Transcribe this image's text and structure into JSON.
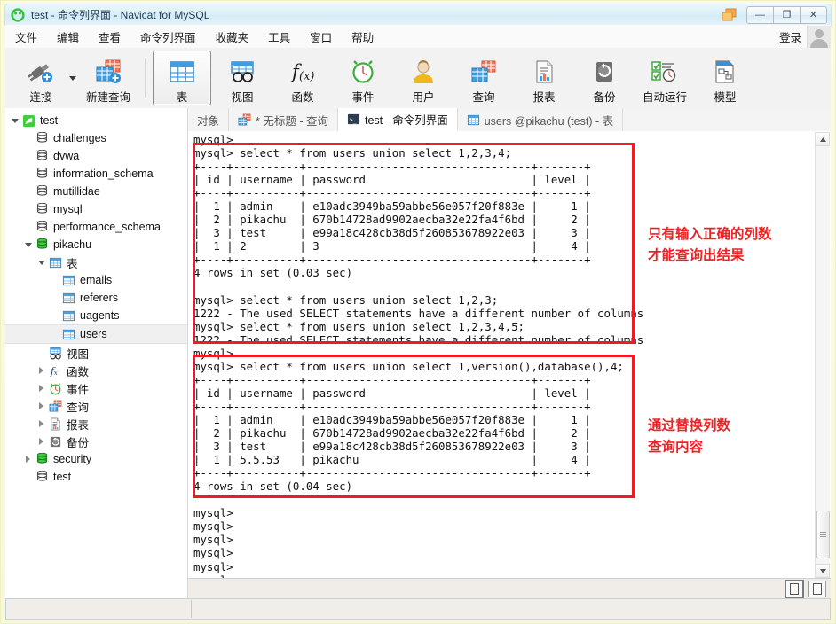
{
  "window": {
    "title": "test - 命令列界面 - Navicat for MySQL",
    "app_icon": "navicat-logo-icon",
    "controls": {
      "restore_stack": "❐",
      "minimize": "—",
      "maximize": "❐",
      "close": "✕"
    }
  },
  "menubar": {
    "items": [
      "文件",
      "编辑",
      "查看",
      "命令列界面",
      "收藏夹",
      "工具",
      "窗口",
      "帮助"
    ],
    "login_label": "登录"
  },
  "toolbar": {
    "buttons": [
      {
        "label": "连接",
        "icon": "connection-plug-icon",
        "active": false,
        "has_dropdown": true
      },
      {
        "label": "新建查询",
        "icon": "new-query-icon",
        "active": false,
        "has_dropdown": false
      },
      {
        "label": "表",
        "icon": "table-grid-icon",
        "active": true,
        "has_dropdown": false
      },
      {
        "label": "视图",
        "icon": "view-glasses-icon",
        "active": false,
        "has_dropdown": false
      },
      {
        "label": "函数",
        "icon": "function-fx-icon",
        "active": false,
        "has_dropdown": false
      },
      {
        "label": "事件",
        "icon": "event-clock-icon",
        "active": false,
        "has_dropdown": false
      },
      {
        "label": "用户",
        "icon": "user-person-icon",
        "active": false,
        "has_dropdown": false
      },
      {
        "label": "查询",
        "icon": "query-table-icon",
        "active": false,
        "has_dropdown": false
      },
      {
        "label": "报表",
        "icon": "report-document-icon",
        "active": false,
        "has_dropdown": false
      },
      {
        "label": "备份",
        "icon": "backup-restore-icon",
        "active": false,
        "has_dropdown": false
      },
      {
        "label": "自动运行",
        "icon": "automation-schedule-icon",
        "active": false,
        "has_dropdown": false
      },
      {
        "label": "模型",
        "icon": "model-diagram-icon",
        "active": false,
        "has_dropdown": false
      }
    ]
  },
  "sidebar": {
    "nodes": [
      {
        "label": "test",
        "indent": 0,
        "icon": "connection-icon",
        "expander": "open",
        "selected": false
      },
      {
        "label": "challenges",
        "indent": 1,
        "icon": "database-icon",
        "expander": "none",
        "selected": false
      },
      {
        "label": "dvwa",
        "indent": 1,
        "icon": "database-icon",
        "expander": "none",
        "selected": false
      },
      {
        "label": "information_schema",
        "indent": 1,
        "icon": "database-icon",
        "expander": "none",
        "selected": false
      },
      {
        "label": "mutillidae",
        "indent": 1,
        "icon": "database-icon",
        "expander": "none",
        "selected": false
      },
      {
        "label": "mysql",
        "indent": 1,
        "icon": "database-icon",
        "expander": "none",
        "selected": false
      },
      {
        "label": "performance_schema",
        "indent": 1,
        "icon": "database-icon",
        "expander": "none",
        "selected": false
      },
      {
        "label": "pikachu",
        "indent": 1,
        "icon": "database-open-icon",
        "expander": "open",
        "selected": false
      },
      {
        "label": "表",
        "indent": 2,
        "icon": "table-grid-icon",
        "expander": "open",
        "selected": false
      },
      {
        "label": "emails",
        "indent": 3,
        "icon": "table-grid-icon",
        "expander": "none",
        "selected": false
      },
      {
        "label": "referers",
        "indent": 3,
        "icon": "table-grid-icon",
        "expander": "none",
        "selected": false
      },
      {
        "label": "uagents",
        "indent": 3,
        "icon": "table-grid-icon",
        "expander": "none",
        "selected": false
      },
      {
        "label": "users",
        "indent": 3,
        "icon": "table-grid-icon",
        "expander": "none",
        "selected": true
      },
      {
        "label": "视图",
        "indent": 2,
        "icon": "view-glasses-icon",
        "expander": "none",
        "selected": false
      },
      {
        "label": "函数",
        "indent": 2,
        "icon": "function-fx-icon",
        "expander": "closed",
        "selected": false
      },
      {
        "label": "事件",
        "indent": 2,
        "icon": "event-clock-icon",
        "expander": "closed",
        "selected": false
      },
      {
        "label": "查询",
        "indent": 2,
        "icon": "query-table-icon",
        "expander": "closed",
        "selected": false
      },
      {
        "label": "报表",
        "indent": 2,
        "icon": "report-document-icon",
        "expander": "closed",
        "selected": false
      },
      {
        "label": "备份",
        "indent": 2,
        "icon": "backup-restore-icon",
        "expander": "closed",
        "selected": false
      },
      {
        "label": "security",
        "indent": 1,
        "icon": "database-open-icon",
        "expander": "closed",
        "selected": false
      },
      {
        "label": "test",
        "indent": 1,
        "icon": "database-icon",
        "expander": "none",
        "selected": false
      }
    ]
  },
  "tabs": [
    {
      "label": "对象",
      "icon": "none",
      "active": false
    },
    {
      "label": "* 无标题 - 查询",
      "icon": "query-table-icon",
      "active": false
    },
    {
      "label": "test - 命令列界面",
      "icon": "console-icon",
      "active": true
    },
    {
      "label": "users @pikachu (test) - 表",
      "icon": "table-grid-icon",
      "active": false
    }
  ],
  "console": {
    "lines": [
      "mysql>",
      "mysql> select * from users union select 1,2,3,4;",
      "+----+----------+----------------------------------+-------+",
      "| id | username | password                         | level |",
      "+----+----------+----------------------------------+-------+",
      "|  1 | admin    | e10adc3949ba59abbe56e057f20f883e |     1 |",
      "|  2 | pikachu  | 670b14728ad9902aecba32e22fa4f6bd |     2 |",
      "|  3 | test     | e99a18c428cb38d5f260853678922e03 |     3 |",
      "|  1 | 2        | 3                                |     4 |",
      "+----+----------+----------------------------------+-------+",
      "4 rows in set (0.03 sec)",
      "",
      "mysql> select * from users union select 1,2,3;",
      "1222 - The used SELECT statements have a different number of columns",
      "mysql> select * from users union select 1,2,3,4,5;",
      "1222 - The used SELECT statements have a different number of columns",
      "mysql>",
      "mysql> select * from users union select 1,version(),database(),4;",
      "+----+----------+----------------------------------+-------+",
      "| id | username | password                         | level |",
      "+----+----------+----------------------------------+-------+",
      "|  1 | admin    | e10adc3949ba59abbe56e057f20f883e |     1 |",
      "|  2 | pikachu  | 670b14728ad9902aecba32e22fa4f6bd |     2 |",
      "|  3 | test     | e99a18c428cb38d5f260853678922e03 |     3 |",
      "|  1 | 5.5.53   | pikachu                          |     4 |",
      "+----+----------+----------------------------------+-------+",
      "4 rows in set (0.04 sec)",
      "",
      "mysql>",
      "mysql>",
      "mysql>",
      "mysql>",
      "mysql>",
      "mysql>"
    ]
  },
  "annotations": {
    "color": "#ee2124",
    "note_1": "只有输入正确的列数\n才能查询出结果",
    "note_2": "通过替换列数\n查询内容"
  },
  "statusbar": {
    "toggle_a": "split-pane-on-icon",
    "toggle_b": "split-pane-off-icon"
  }
}
